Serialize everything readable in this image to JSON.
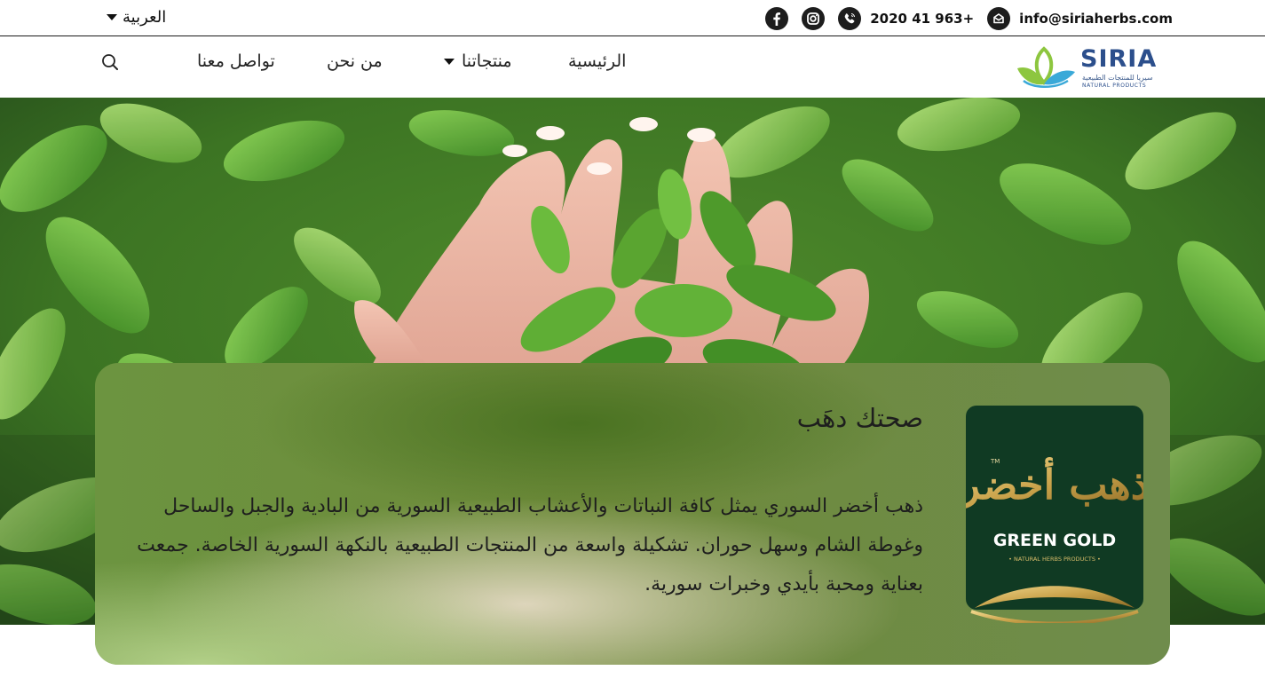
{
  "topbar": {
    "language": "العربية",
    "phone": "2020 41 963+",
    "email": "info@siriaherbs.com",
    "icons": [
      "facebook-icon",
      "instagram-icon",
      "phone-icon",
      "mail-icon"
    ]
  },
  "nav": {
    "home": "الرئيسية",
    "products": "منتجاتنا",
    "about": "من نحن",
    "contact": "تواصل معنا"
  },
  "logo": {
    "name": "SIRIA",
    "arabic": "سيريا للمنتجات الطبيعية",
    "tagline": "NATURAL PRODUCTS"
  },
  "hero": {
    "title": "صحتك دهَب",
    "body": "ذهب أخضر السوري يمثل كافة النباتات والأعشاب الطبيعية السورية من البادية والجبل والساحل وغوطة الشام وسهل حوران. تشكيلة واسعة من المنتجات الطبيعية بالنكهة السورية الخاصة. جمعت بعناية ومحبة بأيدي وخبرات سورية."
  },
  "badge": {
    "arabic": "ذهب أخضر",
    "tm": "TM",
    "brand": "GREEN GOLD",
    "tagline": "• NATURAL HERBS PRODUCTS •"
  },
  "colors": {
    "brand_blue": "#2c4f8c",
    "leaf_green": "#8dc63f",
    "card_green": "#5a7c2e",
    "badge_green": "#103a23",
    "gold": "#c9a24a"
  }
}
